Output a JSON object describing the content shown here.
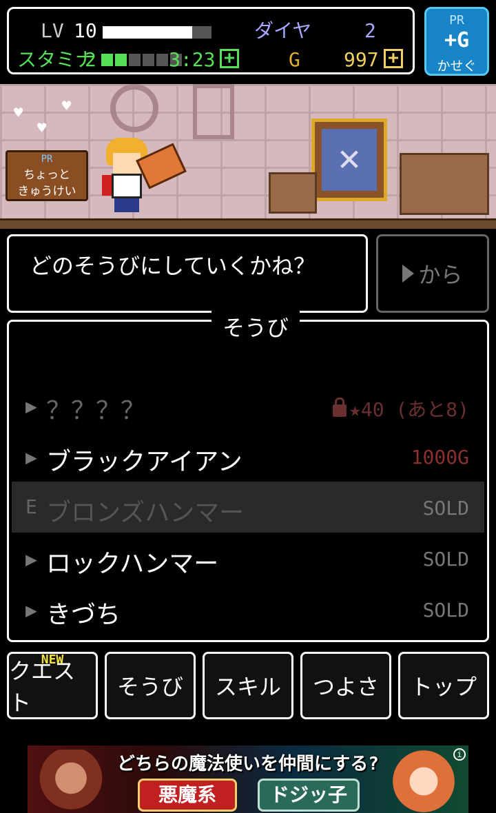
{
  "status": {
    "lv_label": "LV",
    "lv_value": "10",
    "exp_progress": 0.82,
    "diamond_label": "ダイヤ",
    "diamond_value": "2",
    "stamina_label": "スタミナ",
    "stamina_value": "2",
    "stamina_max": 6,
    "stamina_timer": "3:23",
    "gold_label": "G",
    "gold_value": "997",
    "plus_glyph": "+"
  },
  "pr_gold_button": {
    "pr": "PR",
    "main": "+G",
    "sub": "かせぐ"
  },
  "scene": {
    "sign_pr": "PR",
    "sign_line1": "ちょっと",
    "sign_line2": "きゅうけい"
  },
  "dialog": {
    "text": "どのそうびにしていくかね？"
  },
  "kara_button": {
    "label": "から"
  },
  "equipment": {
    "title": "そうび",
    "items": [
      {
        "marker": "▶",
        "name": "？？？？",
        "price": "★40 (あと8)",
        "state": "locked"
      },
      {
        "marker": "▶",
        "name": "ブラックアイアン",
        "price": "1000G",
        "state": "buyable"
      },
      {
        "marker": "E",
        "name": "ブロンズハンマー",
        "price": "SOLD",
        "state": "equipped"
      },
      {
        "marker": "▶",
        "name": "ロックハンマー",
        "price": "SOLD",
        "state": "sold"
      },
      {
        "marker": "▶",
        "name": "きづち",
        "price": "SOLD",
        "state": "sold"
      }
    ]
  },
  "tabs": {
    "new_badge": "NEW",
    "items": [
      {
        "label": "クエスト"
      },
      {
        "label": "そうび"
      },
      {
        "label": "スキル"
      },
      {
        "label": "つよさ"
      },
      {
        "label": "トップ"
      }
    ]
  },
  "ad": {
    "title": "どちらの魔法使いを仲間にする?",
    "option1": "悪魔系",
    "option2": "ドジッ子",
    "info": "i"
  },
  "colors": {
    "stamina": "#55e055",
    "gold": "#f0d060",
    "diamond": "#a8a8ff",
    "pr_button": "#1884c8",
    "locked_price": "#6a3030"
  }
}
